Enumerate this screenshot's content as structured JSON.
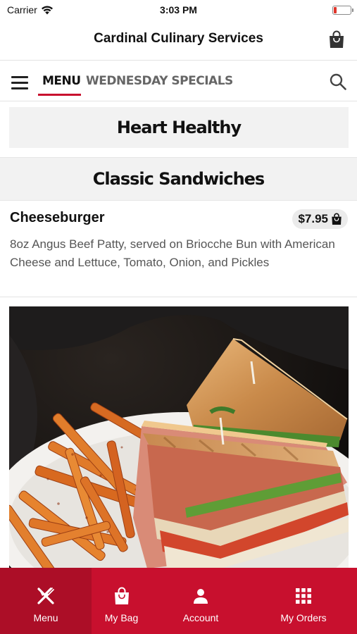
{
  "status_bar": {
    "carrier": "Carrier",
    "time": "3:03 PM",
    "battery_level": 0.1
  },
  "header": {
    "title": "Cardinal Culinary Services",
    "bag_icon": "shopping-bag-icon"
  },
  "tabs": {
    "items": [
      {
        "label": "MENU",
        "active": true
      },
      {
        "label": "WEDNESDAY SPECIALS",
        "active": false
      }
    ],
    "menu_icon": "hamburger-menu-icon",
    "search_icon": "search-icon"
  },
  "sections": {
    "heart_healthy": "Heart Healthy",
    "classic_sandwiches": "Classic Sandwiches"
  },
  "item": {
    "name": "Cheeseburger",
    "price": "$7.95",
    "description": "8oz Angus Beef Patty, served on Briocche Bun with American Cheese and Lettuce, Tomato, Onion, and Pickles",
    "photo_icon": "club-sandwich-with-fries-photo"
  },
  "bottom_nav": {
    "items": [
      {
        "label": "Menu",
        "icon": "fork-knife-icon",
        "active": true
      },
      {
        "label": "My Bag",
        "icon": "shopping-bag-icon",
        "active": false
      },
      {
        "label": "Account",
        "icon": "person-icon",
        "active": false
      },
      {
        "label": "My Orders",
        "icon": "grid-icon",
        "active": false
      }
    ]
  },
  "colors": {
    "brand_red": "#c8102e",
    "active_nav": "#ac0e27",
    "section_background": "#f2f2f2"
  }
}
